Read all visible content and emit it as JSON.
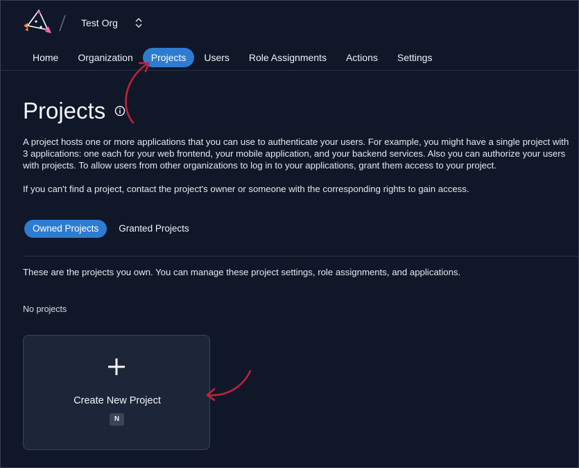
{
  "header": {
    "org_name": "Test Org",
    "logo_icon": "zitadel-logo-icon",
    "switch_icon": "chevron-up-down-icon"
  },
  "nav": {
    "items": [
      {
        "label": "Home",
        "active": false
      },
      {
        "label": "Organization",
        "active": false
      },
      {
        "label": "Projects",
        "active": true
      },
      {
        "label": "Users",
        "active": false
      },
      {
        "label": "Role Assignments",
        "active": false
      },
      {
        "label": "Actions",
        "active": false
      },
      {
        "label": "Settings",
        "active": false
      }
    ]
  },
  "page": {
    "title": "Projects",
    "info_icon": "info-icon",
    "description": "A project hosts one or more applications that you can use to authenticate your users. For example, you might have a single project with 3 applications: one each for your web frontend, your mobile application, and your backend services. Also you can authorize your users with projects. To allow users from other organizations to log in to your applications, grant them access to your project.",
    "description2": "If you can't find a project, contact the project's owner or someone with the corresponding rights to gain access."
  },
  "tabs": [
    {
      "label": "Owned Projects",
      "active": true
    },
    {
      "label": "Granted Projects",
      "active": false
    }
  ],
  "owned": {
    "description": "These are the projects you own. You can manage these project settings, role assignments, and applications.",
    "empty_text": "No projects"
  },
  "create_card": {
    "label": "Create New Project",
    "shortcut": "N",
    "icon": "plus-icon"
  },
  "colors": {
    "background": "#0f1729",
    "accent": "#2d7cd2",
    "card": "#1d2638",
    "annotation": "#c4213a"
  }
}
